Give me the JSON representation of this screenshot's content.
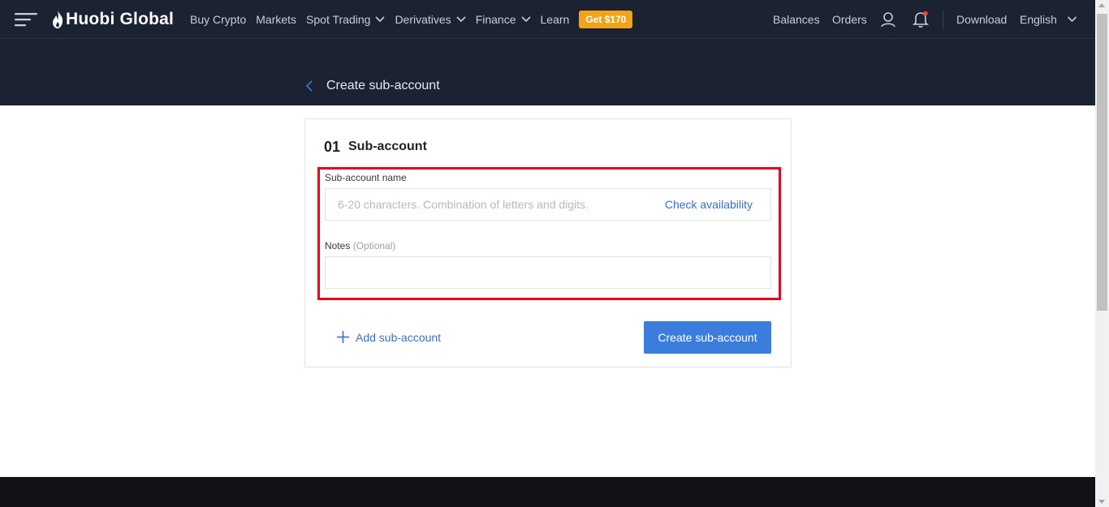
{
  "nav": {
    "logo_text_a": "Huo",
    "logo_text_b": "bi",
    "logo_text_c": " Global",
    "links": [
      {
        "label": "Buy Crypto",
        "dropdown": false
      },
      {
        "label": "Markets",
        "dropdown": false
      },
      {
        "label": "Spot Trading",
        "dropdown": true
      },
      {
        "label": "Derivatives",
        "dropdown": true
      },
      {
        "label": "Finance",
        "dropdown": true
      },
      {
        "label": "Learn",
        "dropdown": false
      }
    ],
    "promo": "Get $170",
    "balances": "Balances",
    "orders": "Orders",
    "download": "Download",
    "language": "English"
  },
  "header": {
    "title": "Create sub-account"
  },
  "form": {
    "step_number": "01",
    "step_title": "Sub-account",
    "name_label": "Sub-account name",
    "name_placeholder": "6-20 characters. Combination of letters and digits.",
    "name_value": "",
    "check_availability": "Check availability",
    "notes_label": "Notes",
    "notes_optional": "(Optional)",
    "notes_value": "",
    "add_sub_account": "Add sub-account",
    "create_button": "Create sub-account"
  },
  "colors": {
    "nav_bg": "#1b2232",
    "accent_blue": "#3b7ddd",
    "link_blue": "#3a6fc4",
    "promo_orange": "#f0a31b",
    "highlight_red": "#e3001b",
    "footer_bg": "#121318"
  }
}
